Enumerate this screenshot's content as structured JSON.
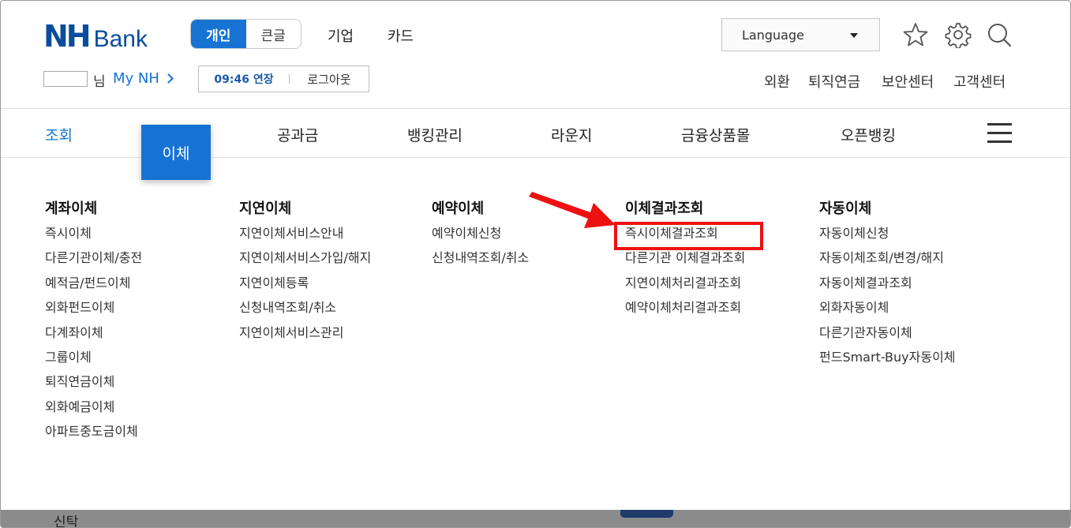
{
  "header": {
    "logo_nh": "NH",
    "logo_bank": "Bank",
    "size_options": [
      "개인",
      "큰글"
    ],
    "top_links": [
      "기업",
      "카드"
    ],
    "language_label": "Language",
    "user_suffix": "님",
    "my_nh": "My NH",
    "session_time": "09:46 연장",
    "logout": "로그아웃",
    "util_links": [
      "외환",
      "퇴직연금",
      "보안센터",
      "고객센터"
    ]
  },
  "gnb": {
    "items": [
      "조회",
      "이체",
      "공과금",
      "뱅킹관리",
      "라운지",
      "금융상품몰",
      "오픈뱅킹"
    ]
  },
  "menu": {
    "columns": [
      {
        "title": "계좌이체",
        "items": [
          "즉시이체",
          "다른기관이체/충전",
          "예적금/펀드이체",
          "외화펀드이체",
          "다계좌이체",
          "그룹이체",
          "퇴직연금이체",
          "외화예금이체",
          "아파트중도금이체"
        ]
      },
      {
        "title": "지연이체",
        "items": [
          "지연이체서비스안내",
          "지연이체서비스가입/해지",
          "지연이체등록",
          "신청내역조회/취소",
          "지연이체서비스관리"
        ]
      },
      {
        "title": "예약이체",
        "items": [
          "예약이체신청",
          "신청내역조회/취소"
        ]
      },
      {
        "title": "이체결과조회",
        "items": [
          "즉시이체결과조회",
          "다른기관 이체결과조회",
          "지연이체처리결과조회",
          "예약이체처리결과조회"
        ]
      },
      {
        "title": "자동이체",
        "items": [
          "자동이체신청",
          "자동이체조회/변경/해지",
          "자동이체결과조회",
          "외화자동이체",
          "다른기관자동이체",
          "펀드Smart-Buy자동이체"
        ]
      }
    ]
  },
  "bottom": {
    "text": "신탁"
  },
  "colors": {
    "brand_blue": "#1673d3",
    "logo_blue": "#0a4d9c",
    "highlight_red": "#ee1111"
  }
}
